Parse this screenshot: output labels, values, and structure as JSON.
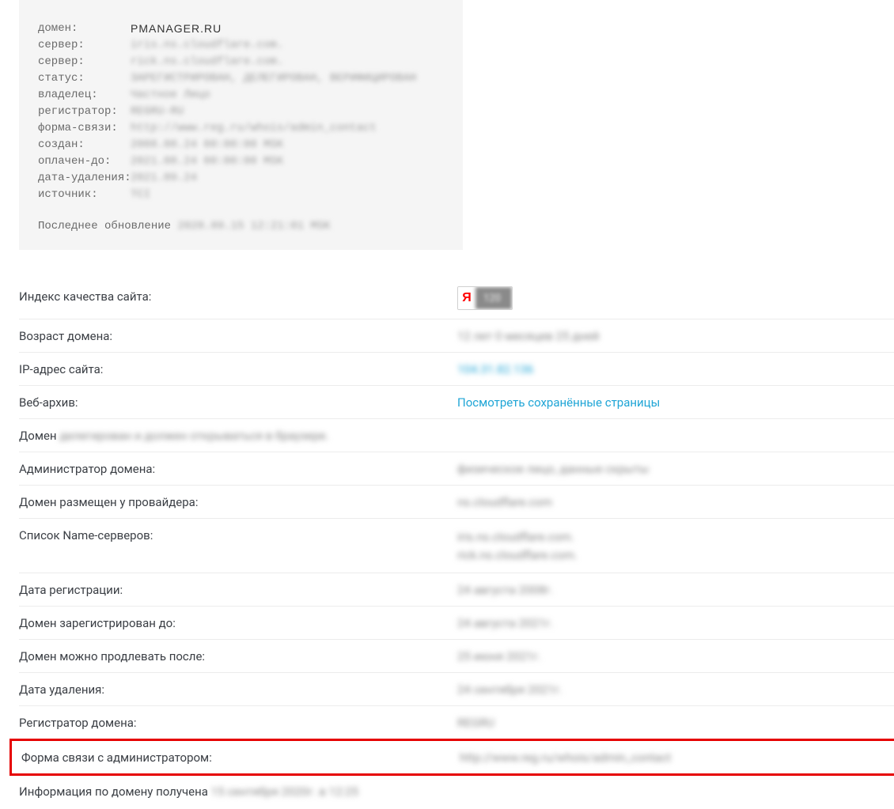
{
  "whois": {
    "labels": {
      "domain": "домен:",
      "server1": "сервер:",
      "server2": "сервер:",
      "status": "статус:",
      "owner": "владелец:",
      "registrar": "регистратор:",
      "contact_form": "форма-связи:",
      "created": "создан:",
      "paid_till": "оплачен-до:",
      "delete_date": "дата-удаления:",
      "source": "источник:"
    },
    "values": {
      "domain": "PMANAGER.RU",
      "server1": "iris.ns.cloudflare.com.",
      "server2": "rick.ns.cloudflare.com.",
      "status": "ЗАРЕГИСТРИРОВАН, ДЕЛЕГИРОВАН, ВЕРИФИЦИРОВАН",
      "owner": "Частное Лицо",
      "registrar": "REGRU-RU",
      "contact_form": "http://www.reg.ru/whois/admin_contact",
      "created": "2008.08.24 00:00:00 MSK",
      "paid_till": "2021.08.24 00:00:00 MSK",
      "delete_date": "2021.09.24",
      "source": "TCI"
    },
    "last_update_label": "Последнее обновление",
    "last_update_value": "2020.09.15 12:21:01 MSK"
  },
  "info": {
    "quality_label": "Индекс качества сайта:",
    "yandex_letter": "Я",
    "yandex_score": "120",
    "age_label": "Возраст домена:",
    "age_value": "12 лет 0 месяцев 25 дней",
    "ip_label": "IP-адрес сайта:",
    "ip_value": "104.31.82.136",
    "archive_label": "Веб-архив:",
    "archive_link": "Посмотреть сохранённые страницы",
    "delegated_prefix": "Домен",
    "delegated_value": "делегирован и должен открываться в браузере.",
    "admin_label": "Администратор домена:",
    "admin_value": "физическое лицо, данные скрыты",
    "provider_label": "Домен размещен у провайдера:",
    "provider_value": "ns.cloudflare.com",
    "ns_label": "Список Name-серверов:",
    "ns_value1": "iris.ns.cloudflare.com.",
    "ns_value2": "rick.ns.cloudflare.com.",
    "regdate_label": "Дата регистрации:",
    "regdate_value": "24 августа 2008г.",
    "reguntil_label": "Домен зарегистрирован до:",
    "reguntil_value": "24 августа 2021г.",
    "renew_label": "Домен можно продлевать после:",
    "renew_value": "25 июня 2021г.",
    "deldate_label": "Дата удаления:",
    "deldate_value": "24 сентября 2021г.",
    "registrar_label": "Регистратор домена:",
    "registrar_value": "REGRU",
    "contact_label": "Форма связи с администратором:",
    "contact_value": "http://www.reg.ru/whois/admin_contact",
    "fetched_prefix": "Информация по домену получена",
    "fetched_value": "15 сентября 2020г. в 12:25"
  }
}
